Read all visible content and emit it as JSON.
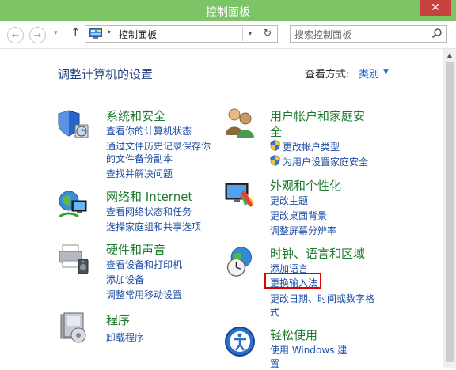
{
  "window": {
    "title": "控制面板",
    "close_symbol": "✕"
  },
  "nav": {
    "back_symbol": "←",
    "forward_symbol": "→",
    "dropdown_symbol": "▾",
    "up_symbol": "↑"
  },
  "address": {
    "separator": "▸",
    "crumb": "控制面板",
    "dropdown_symbol": "▾",
    "refresh_symbol": "↻"
  },
  "search": {
    "placeholder": "搜索控制面板"
  },
  "header": {
    "title": "调整计算机的设置",
    "view_by_label": "查看方式:",
    "view_by_value": "类别",
    "view_by_arrow": "▼"
  },
  "categories": {
    "system": {
      "title": "系统和安全",
      "links": [
        "查看你的计算机状态",
        "通过文件历史记录保存你",
        "的文件备份副本",
        "查找并解决问题"
      ]
    },
    "network": {
      "title": "网络和 Internet",
      "links": [
        "查看网络状态和任务",
        "选择家庭组和共享选项"
      ]
    },
    "hardware": {
      "title": "硬件和声音",
      "links": [
        "查看设备和打印机",
        "添加设备",
        "调整常用移动设置"
      ]
    },
    "programs": {
      "title": "程序",
      "links": [
        "卸载程序"
      ]
    },
    "users": {
      "title_line1": "用户帐户和家庭安",
      "title_line2": "全",
      "links": [
        "更改帐户类型",
        "为用户设置家庭安全"
      ]
    },
    "appearance": {
      "title": "外观和个性化",
      "links": [
        "更改主题",
        "更改桌面背景",
        "调整屏幕分辨率"
      ]
    },
    "clock": {
      "title": "时钟、语言和区域",
      "links": [
        "添加语言",
        "更换输入法",
        "更改日期、时间或数字格",
        "式"
      ]
    },
    "ease": {
      "title": "轻松使用",
      "links": [
        "使用 Windows 建",
        "置"
      ]
    }
  },
  "colors": {
    "titlebar": "#7dc466",
    "category_title": "#1e7a2e",
    "link": "#1f4ea3",
    "highlight_box": "#e00000"
  },
  "icons": [
    "control-panel-icon",
    "search-icon",
    "system-security-icon",
    "network-icon",
    "hardware-sound-icon",
    "programs-icon",
    "user-accounts-icon",
    "appearance-icon",
    "clock-region-icon",
    "ease-of-access-icon",
    "uac-shield-icon"
  ]
}
